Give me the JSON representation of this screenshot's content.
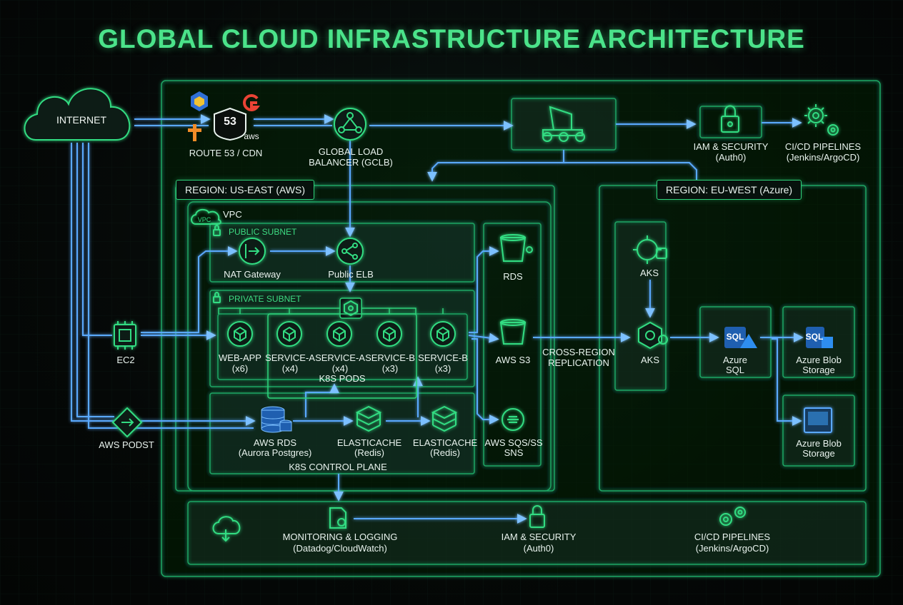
{
  "title": "GLOBAL CLOUD INFRASTRUCTURE ARCHITECTURE",
  "colors": {
    "accent_green": "#2fd27a",
    "wire_blue": "#5aa9ff",
    "background": "#050807"
  },
  "internet": {
    "label": "INTERNET"
  },
  "edge": {
    "route53": {
      "badge": "53",
      "label": "ROUTE 53 / CDN",
      "provider_text": "aws"
    },
    "glb": {
      "label_line1": "GLOBAL LOAD",
      "label_line2": "BALANCER (GCLB)"
    },
    "iam_top": {
      "line1": "IAM & SECURITY",
      "line2": "(Auth0)"
    },
    "cicd_top": {
      "line1": "CI/CD PIPELINES",
      "line2": "(Jenkins/ArgoCD)"
    }
  },
  "us_east": {
    "region_label": "REGION: US-EAST (AWS)",
    "vpc_label": "VPC",
    "vpc_badge": "VPC",
    "public_subnet_label": "PUBLIC SUBNET",
    "private_subnet_label": "PRIVATE SUBNET",
    "nat_gateway": "NAT Gateway",
    "public_elb": "Public ELB",
    "pods": [
      {
        "name": "WEB-APP",
        "count": "(x6)"
      },
      {
        "name": "SERVICE-A",
        "count": "(x4)"
      },
      {
        "name": "SERVICE-A",
        "count": "(x4)"
      },
      {
        "name": "SERVICE-B",
        "count": "(x3)"
      },
      {
        "name": "SERVICE-B",
        "count": "(x3)"
      }
    ],
    "pods_label": "K8S PODS",
    "data_layer": {
      "aws_rds_line1": "AWS RDS",
      "aws_rds_line2": "(Aurora Postgres)",
      "elasticache_1_line1": "ELASTICACHE",
      "elasticache_1_line2": "(Redis)",
      "elasticache_2_line1": "ELASTICACHE",
      "elasticache_2_line2": "(Redis)"
    },
    "control_plane_label": "K8S CONTROL PLANE",
    "rds": "RDS",
    "aws_s3": "AWS S3",
    "sqs_line1": "AWS SQS/SS",
    "sqs_line2": "SNS"
  },
  "left_nodes": {
    "ec2": "EC2",
    "aws_post": "AWS PODST"
  },
  "cross_region": {
    "line1": "CROSS-REGION",
    "line2": "REPLICATION"
  },
  "eu_west": {
    "region_label": "REGION: EU-WEST (Azure)",
    "aks_top": "AKS",
    "aks_bottom": "AKS",
    "azure_sql_line1": "Azure",
    "azure_sql_line2": "SQL",
    "sql_badge": "SQL",
    "blob_1_line1": "Azure Blob",
    "blob_1_line2": "Storage",
    "blob_2_line1": "Azure Blob",
    "blob_2_line2": "Storage"
  },
  "footer": {
    "monitoring_line1": "MONITORING & LOGGING",
    "monitoring_line2": "(Datadog/CloudWatch)",
    "iam_line1": "IAM & SECURITY",
    "iam_line2": "(Auth0)",
    "cicd_line1": "CI/CD PIPELINES",
    "cicd_line2": "(Jenkins/ArgoCD)"
  }
}
